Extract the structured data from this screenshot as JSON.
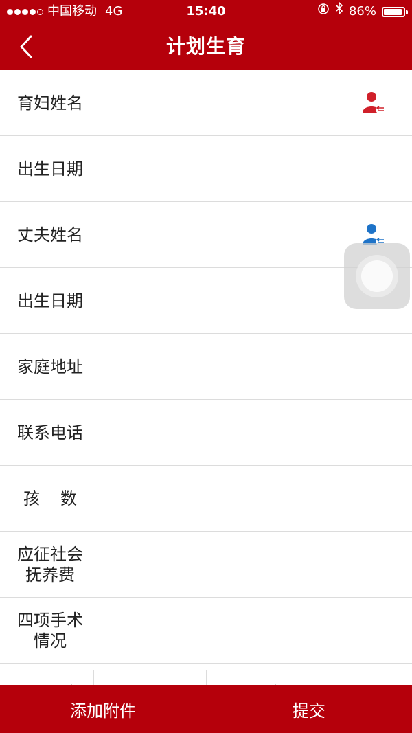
{
  "status_bar": {
    "carrier": "中国移动",
    "network": "4G",
    "time": "15:40",
    "battery": "86%"
  },
  "nav": {
    "title": "计划生育",
    "back_icon": "chevron-left-icon"
  },
  "form": {
    "rows": [
      {
        "label": "育妇姓名",
        "value": "",
        "picker_color": "#d0202a"
      },
      {
        "label": "出生日期",
        "value": ""
      },
      {
        "label": "丈夫姓名",
        "value": "",
        "picker_color": "#1e73c8"
      },
      {
        "label": "出生日期",
        "value": ""
      },
      {
        "label": "家庭地址",
        "value": ""
      },
      {
        "label": "联系电话",
        "value": ""
      },
      {
        "label": "孩数",
        "value": ""
      },
      {
        "label": "应征社会抚养费",
        "value": ""
      },
      {
        "label": "四项手术情况",
        "value": ""
      },
      {
        "label_left": "参加上半",
        "label_right": "参加下半"
      }
    ]
  },
  "bottom_bar": {
    "attach_label": "添加附件",
    "submit_label": "提交"
  },
  "colors": {
    "brand_red": "#b5000b"
  }
}
